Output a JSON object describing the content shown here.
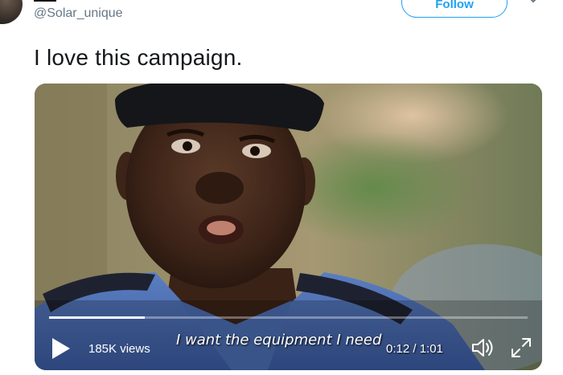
{
  "tweet": {
    "handle": "@Solar_unique",
    "follow_label": "Follow",
    "text": "I love this campaign."
  },
  "video": {
    "subtitle": "I want the equipment I need",
    "views": "185K views",
    "time": "0:12 / 1:01",
    "progress": 0.2
  },
  "icons": {
    "avatar": "avatar",
    "caret": "chevron-down-icon",
    "play": "play-icon",
    "volume": "volume-icon",
    "fullscreen": "fullscreen-icon"
  },
  "colors": {
    "accent": "#1da1f2",
    "secondary_text": "#657786"
  }
}
